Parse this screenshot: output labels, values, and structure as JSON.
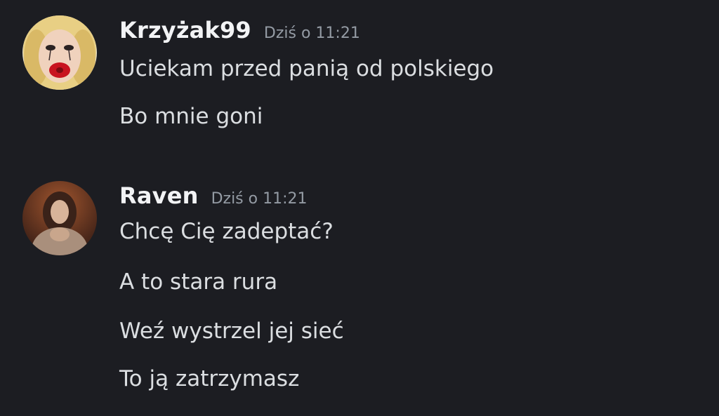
{
  "messages": [
    {
      "username": "Krzyżak99",
      "timestamp": "Dziś o 11:21",
      "lines": [
        "Uciekam przed panią od polskiego",
        "Bo mnie goni"
      ]
    },
    {
      "username": "Raven",
      "timestamp": "Dziś o 11:21",
      "lines": [
        "Chcę Cię zadeptać?",
        "A to stara rura",
        "Weź wystrzel jej sieć",
        "To ją zatrzymasz"
      ]
    }
  ],
  "colors": {
    "background": "#1c1d22",
    "username": "#f2f3f5",
    "timestamp": "#949ba4",
    "message_text": "#dbdee1"
  }
}
